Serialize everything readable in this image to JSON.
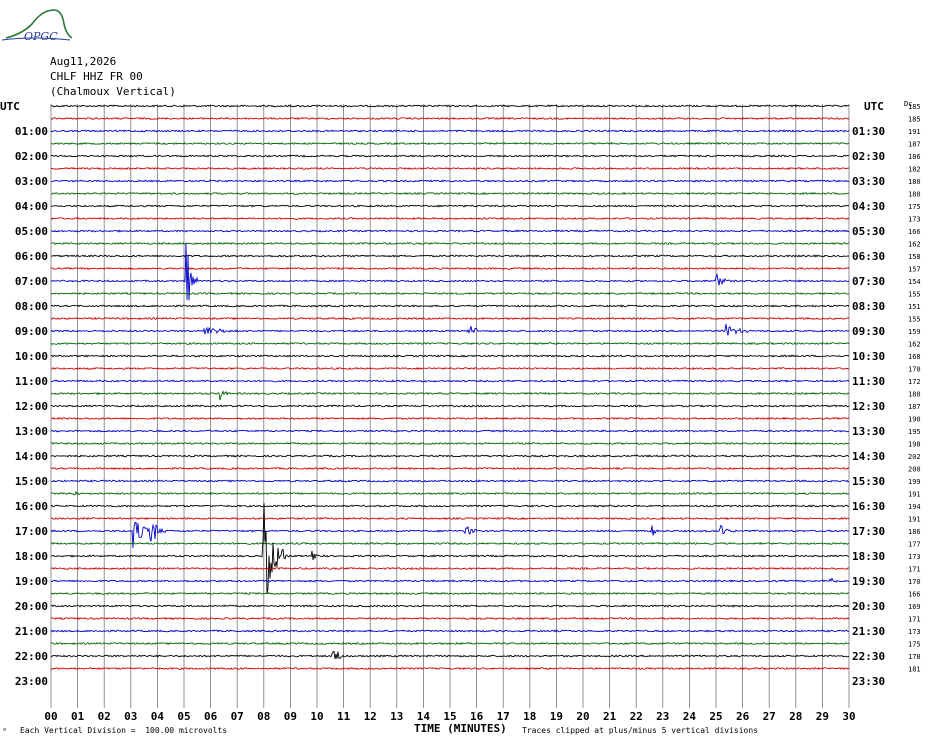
{
  "header": {
    "logo_text": "OPGC",
    "date": "Aug11,2026",
    "station": "CHLF HHZ FR 00",
    "location": "(Chalmoux Vertical)"
  },
  "chart_data": {
    "type": "helicorder",
    "left_axis_label": "UTC",
    "right_axis_label": "UTC",
    "scale_label": "Dc",
    "left_hour_labels": [
      "01:00",
      "02:00",
      "03:00",
      "04:00",
      "05:00",
      "06:00",
      "07:00",
      "08:00",
      "09:00",
      "10:00",
      "11:00",
      "12:00",
      "13:00",
      "14:00",
      "15:00",
      "16:00",
      "17:00",
      "18:00",
      "19:00",
      "20:00",
      "21:00",
      "22:00",
      "23:00"
    ],
    "right_hour_labels": [
      "01:30",
      "02:30",
      "03:30",
      "04:30",
      "05:30",
      "06:30",
      "07:30",
      "08:30",
      "09:30",
      "10:30",
      "11:30",
      "12:30",
      "13:30",
      "14:30",
      "15:30",
      "16:30",
      "17:30",
      "18:30",
      "19:30",
      "20:30",
      "21:30",
      "22:30",
      "23:30"
    ],
    "dc_offsets": [
      185,
      185,
      191,
      187,
      186,
      182,
      180,
      180,
      175,
      173,
      166,
      162,
      158,
      157,
      154,
      155,
      151,
      155,
      159,
      162,
      168,
      170,
      172,
      180,
      187,
      190,
      195,
      198,
      202,
      200,
      199,
      191,
      194,
      191,
      186,
      177,
      173,
      171,
      170,
      166,
      169,
      171,
      173,
      175,
      178,
      181
    ],
    "x_ticks": [
      "00",
      "01",
      "02",
      "03",
      "04",
      "05",
      "06",
      "07",
      "08",
      "09",
      "10",
      "11",
      "12",
      "13",
      "14",
      "15",
      "16",
      "17",
      "18",
      "19",
      "20",
      "21",
      "22",
      "23",
      "24",
      "25",
      "26",
      "27",
      "28",
      "29",
      "30"
    ],
    "x_range": [
      0,
      30
    ],
    "xlabel": "TIME (MINUTES)",
    "trace_colors": [
      "#000000",
      "#cc0000",
      "#0000cc",
      "#006600"
    ],
    "events": [
      {
        "trace": 14,
        "minute": 5.1,
        "amplitude": 3.5,
        "duration": 0.4
      },
      {
        "trace": 14,
        "minute": 25.0,
        "amplitude": 0.8,
        "duration": 0.5
      },
      {
        "trace": 18,
        "minute": 5.8,
        "amplitude": 0.5,
        "duration": 1.2
      },
      {
        "trace": 18,
        "minute": 15.7,
        "amplitude": 0.8,
        "duration": 0.6
      },
      {
        "trace": 18,
        "minute": 25.4,
        "amplitude": 0.8,
        "duration": 0.8
      },
      {
        "trace": 23,
        "minute": 6.4,
        "amplitude": 0.5,
        "duration": 0.3
      },
      {
        "trace": 31,
        "minute": 0.9,
        "amplitude": 0.4,
        "duration": 0.3
      },
      {
        "trace": 34,
        "minute": 3.1,
        "amplitude": 1.4,
        "duration": 0.8
      },
      {
        "trace": 34,
        "minute": 3.7,
        "amplitude": 1.6,
        "duration": 0.6
      },
      {
        "trace": 34,
        "minute": 15.6,
        "amplitude": 0.6,
        "duration": 0.6
      },
      {
        "trace": 34,
        "minute": 22.6,
        "amplitude": 0.5,
        "duration": 0.4
      },
      {
        "trace": 34,
        "minute": 25.2,
        "amplitude": 0.5,
        "duration": 0.6
      },
      {
        "trace": 36,
        "minute": 8.0,
        "amplitude": 5.0,
        "duration": 0.8
      },
      {
        "trace": 36,
        "minute": 9.8,
        "amplitude": 0.6,
        "duration": 0.5
      },
      {
        "trace": 38,
        "minute": 29.3,
        "amplitude": 0.6,
        "duration": 0.3
      },
      {
        "trace": 44,
        "minute": 10.6,
        "amplitude": 0.9,
        "duration": 0.5
      }
    ],
    "footer_left": "Each Vertical Division =  100.00 microvolts",
    "footer_right": "Traces clipped at plus/minus 5 vertical divisions"
  }
}
